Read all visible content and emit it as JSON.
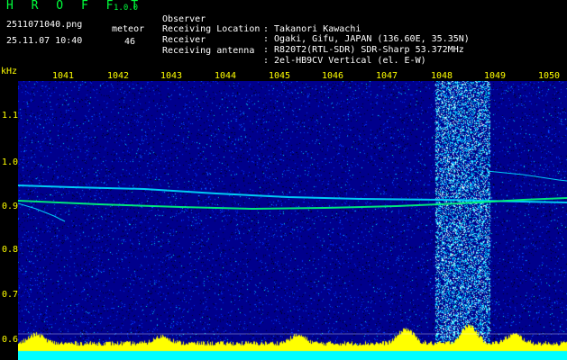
{
  "app": {
    "title": "H R O F F T",
    "version": "1.0.0"
  },
  "file": {
    "name": "2511071040.png",
    "timestamp": "25.11.07 10:40"
  },
  "meteor": {
    "label": "meteor",
    "count": "46"
  },
  "info": [
    {
      "label": "Observer",
      "value": ": Takanori Kawachi"
    },
    {
      "label": "Receiving Location",
      "value": ": Ogaki, Gifu, JAPAN (136.60E, 35.35N)"
    },
    {
      "label": "Receiver",
      "value": ": R820T2(RTL-SDR) SDR-Sharp 53.372MHz"
    },
    {
      "label": "Receiving antenna",
      "value": ": 2el-HB9CV Vertical (el. E-W)"
    }
  ],
  "axis": {
    "unit": "kHz",
    "x_ticks": [
      "1041",
      "1042",
      "1043",
      "1044",
      "1045",
      "1046",
      "1047",
      "1048",
      "1049",
      "1050"
    ],
    "y_ticks": [
      "1.1",
      "1.0",
      "0.9",
      "0.8",
      "0.7",
      "0.6"
    ]
  },
  "colors": {
    "background": "#000000",
    "noise_low": "#00008c",
    "noise_mid": "#0030ff",
    "noise_high": "#00e0ff",
    "signal": "#00ff7a",
    "signal_peak": "#ff3030",
    "tick_text": "#ffff00",
    "title_green": "#00ff3c",
    "bottom_band": "#00ffff",
    "spectrum": "#ffff00"
  }
}
